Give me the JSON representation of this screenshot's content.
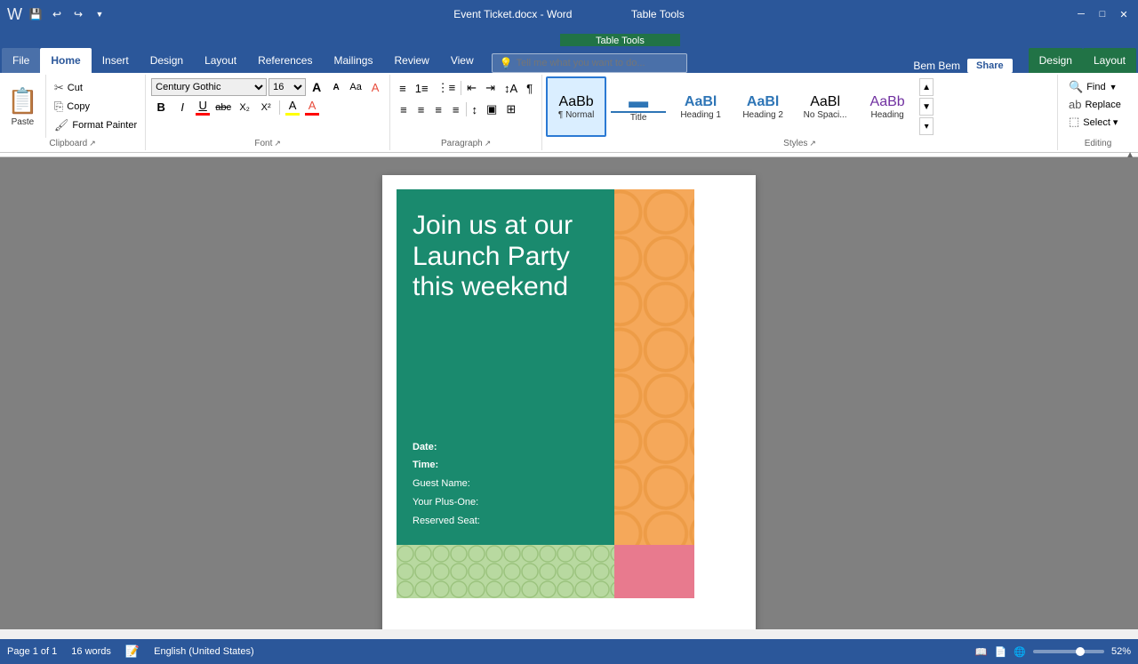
{
  "titleBar": {
    "docName": "Event Ticket.docx - Word",
    "tableTools": "Table Tools",
    "windowButtons": [
      "─",
      "□",
      "✕"
    ]
  },
  "qat": {
    "buttons": [
      "💾",
      "↩",
      "↪",
      "▼"
    ]
  },
  "tabs": [
    {
      "id": "file",
      "label": "File",
      "active": false
    },
    {
      "id": "home",
      "label": "Home",
      "active": true
    },
    {
      "id": "insert",
      "label": "Insert",
      "active": false
    },
    {
      "id": "design",
      "label": "Design",
      "active": false
    },
    {
      "id": "layout",
      "label": "Layout",
      "active": false
    },
    {
      "id": "references",
      "label": "References",
      "active": false
    },
    {
      "id": "mailings",
      "label": "Mailings",
      "active": false
    },
    {
      "id": "review",
      "label": "Review",
      "active": false
    },
    {
      "id": "view",
      "label": "View",
      "active": false
    }
  ],
  "contextualTabs": [
    {
      "id": "table-design",
      "label": "Design",
      "context": "Table Tools"
    },
    {
      "id": "table-layout",
      "label": "Layout",
      "context": "Table Tools"
    }
  ],
  "ribbon": {
    "clipboard": {
      "groupLabel": "Clipboard",
      "pasteLabel": "Paste",
      "cutLabel": "Cut",
      "copyLabel": "Copy",
      "formatPainterLabel": "Format Painter"
    },
    "font": {
      "groupLabel": "Font",
      "fontFamily": "Century Gothic",
      "fontSize": "16",
      "growLabel": "A",
      "shrinkLabel": "A",
      "caseLabel": "Aa",
      "clearLabel": "A",
      "boldLabel": "B",
      "italicLabel": "I",
      "underlineLabel": "U",
      "strikeLabel": "abc",
      "subLabel": "X₂",
      "supLabel": "X²",
      "highlightLabel": "A",
      "colorLabel": "A"
    },
    "paragraph": {
      "groupLabel": "Paragraph"
    },
    "styles": {
      "groupLabel": "Styles",
      "items": [
        {
          "id": "normal",
          "label": "¶ Normal",
          "preview": "AaBb",
          "active": true
        },
        {
          "id": "title",
          "label": "Title",
          "preview": "▬▬",
          "active": false
        },
        {
          "id": "heading1",
          "label": "Heading 1",
          "preview": "AaBl",
          "active": false
        },
        {
          "id": "heading2",
          "label": "Heading 2",
          "preview": "AaBl",
          "active": false
        },
        {
          "id": "nospacing",
          "label": "No Spaci...",
          "preview": "AaBl",
          "active": false
        },
        {
          "id": "heading3",
          "label": "Heading",
          "preview": "AaBb",
          "active": false
        }
      ]
    },
    "editing": {
      "groupLabel": "Editing",
      "findLabel": "Find",
      "replaceLabel": "Replace",
      "selectLabel": "Select ▾"
    }
  },
  "document": {
    "ticket": {
      "mainBg": "#1a8a6e",
      "orangeBg": "#f5a85a",
      "pinkBg": "#e87a8e",
      "greenBottomBg": "#c5e0b4",
      "titleText": "Join us at our Launch Party this weekend",
      "date": "Date:",
      "time": "Time:",
      "guestName": "Guest Name:",
      "plusOne": "Your Plus-One:",
      "reservedSeat": "Reserved Seat:"
    }
  },
  "statusBar": {
    "page": "Page 1 of 1",
    "words": "16 words",
    "language": "English (United States)",
    "zoom": "52%"
  },
  "searchBox": {
    "placeholder": "Tell me what you want to do..."
  },
  "userInfo": {
    "name": "Bem Bem",
    "shareLabel": "Share"
  }
}
